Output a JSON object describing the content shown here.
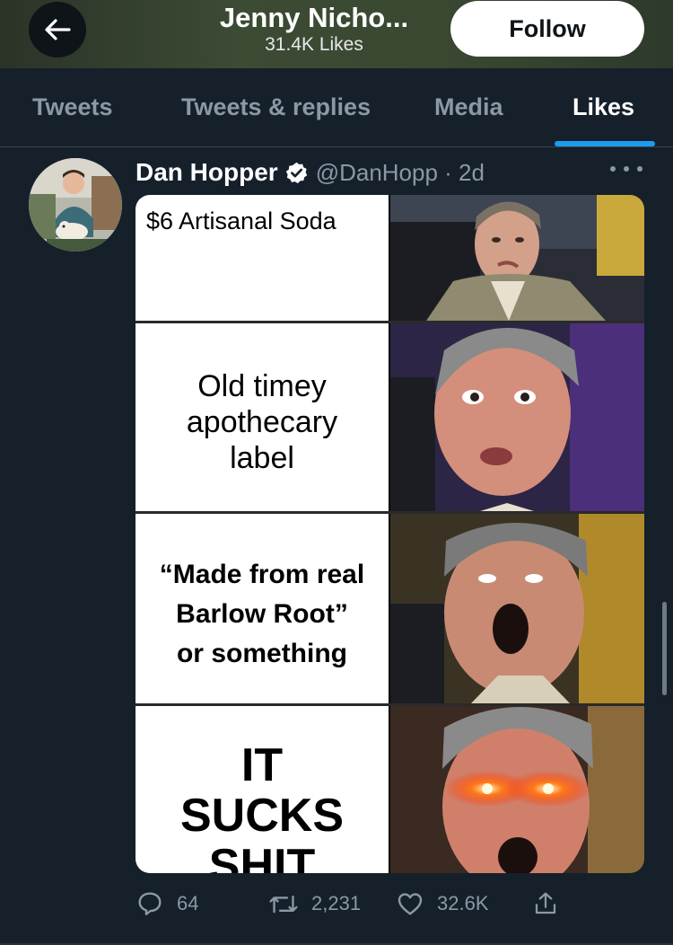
{
  "header": {
    "title": "Jenny Nicho...",
    "subtitle": "31.4K Likes",
    "follow_label": "Follow"
  },
  "tabs": [
    {
      "label": "Tweets",
      "active": false
    },
    {
      "label": "Tweets & replies",
      "active": false
    },
    {
      "label": "Media",
      "active": false
    },
    {
      "label": "Likes",
      "active": true
    }
  ],
  "tweet": {
    "author_name": "Dan Hopper",
    "verified": true,
    "handle_time": "@DanHopp · 2d",
    "meme": {
      "panels": [
        {
          "caption": "$6 Artisanal Soda"
        },
        {
          "caption_lines": [
            "Old timey",
            "apothecary",
            "label"
          ]
        },
        {
          "caption_lines": [
            "“Made from real",
            "Barlow Root”",
            "or something"
          ]
        },
        {
          "caption_lines": [
            "IT",
            "SUCKS",
            "SHIT"
          ]
        }
      ]
    },
    "actions": {
      "replies": "64",
      "retweets": "2,231",
      "likes": "32.6K"
    }
  },
  "colors": {
    "background": "#15202b",
    "accent": "#1d9bf0",
    "muted_text": "#8b98a5",
    "header_bg": "#3c4b34"
  },
  "icons": [
    "back-arrow-icon",
    "verified-badge-icon",
    "more-icon",
    "reply-icon",
    "retweet-icon",
    "like-icon",
    "share-icon"
  ]
}
